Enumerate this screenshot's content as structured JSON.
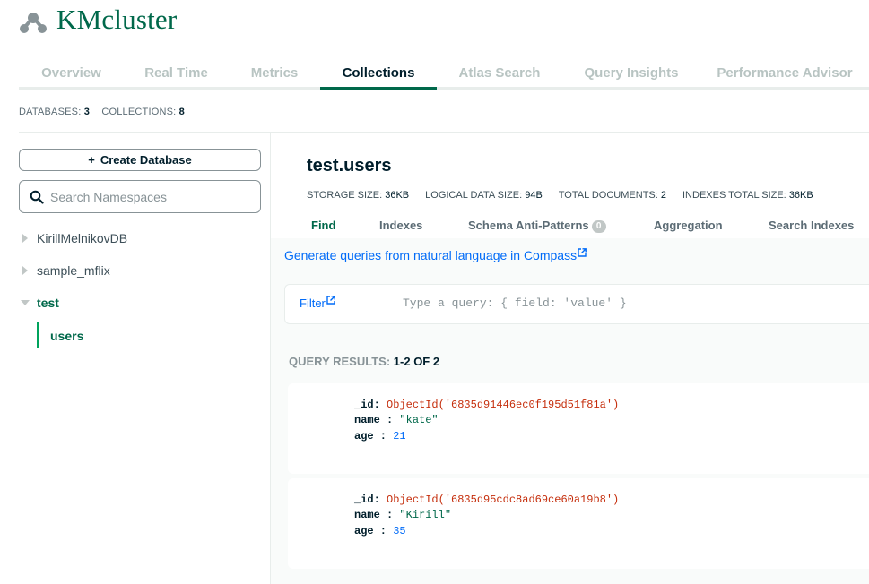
{
  "header": {
    "cluster_name": "KMcluster"
  },
  "tabs": [
    {
      "label": "Overview",
      "active": false
    },
    {
      "label": "Real Time",
      "active": false
    },
    {
      "label": "Metrics",
      "active": false
    },
    {
      "label": "Collections",
      "active": true
    },
    {
      "label": "Atlas Search",
      "active": false
    },
    {
      "label": "Query Insights",
      "active": false
    },
    {
      "label": "Performance Advisor",
      "active": false
    }
  ],
  "summary": {
    "databases_label": "DATABASES:",
    "databases_count": "3",
    "collections_label": "COLLECTIONS:",
    "collections_count": "8"
  },
  "sidebar": {
    "create_db_label": "Create Database",
    "search_placeholder": "Search Namespaces",
    "databases": [
      {
        "name": "KirillMelnikovDB",
        "expanded": false
      },
      {
        "name": "sample_mflix",
        "expanded": false
      },
      {
        "name": "test",
        "expanded": true
      }
    ],
    "active_collection": "users"
  },
  "namespace": {
    "title": "test.users",
    "stats": [
      {
        "label": "STORAGE SIZE:",
        "value": "36KB"
      },
      {
        "label": "LOGICAL DATA SIZE:",
        "value": "94B"
      },
      {
        "label": "TOTAL DOCUMENTS:",
        "value": "2"
      },
      {
        "label": "INDEXES TOTAL SIZE:",
        "value": "36KB"
      }
    ],
    "subtabs": {
      "find": "Find",
      "indexes": "Indexes",
      "schema": "Schema Anti-Patterns",
      "schema_badge": "0",
      "aggregation": "Aggregation",
      "search_indexes": "Search Indexes"
    }
  },
  "compass_link": "Generate queries from natural language in Compass",
  "filter": {
    "label": "Filter",
    "placeholder": "Type a query: { field: 'value' }"
  },
  "results": {
    "label": "QUERY RESULTS:",
    "count": "1-2 OF 2",
    "documents": [
      {
        "id_key": "_id:",
        "id_value": "ObjectId('6835d91446ec0f195d51f81a')",
        "name_key": "name :",
        "name_value": "\"kate\"",
        "age_key": "age :",
        "age_value": "21"
      },
      {
        "id_key": "_id:",
        "id_value": "ObjectId('6835d95cdc8ad69ce60a19b8')",
        "name_key": "name :",
        "name_value": "\"Kirill\"",
        "age_key": "age :",
        "age_value": "35"
      }
    ]
  },
  "colors": {
    "brand_green": "#00684a",
    "accent_green": "#00a35c",
    "link_blue": "#016bf8",
    "objectid_red": "#c52e0c"
  }
}
